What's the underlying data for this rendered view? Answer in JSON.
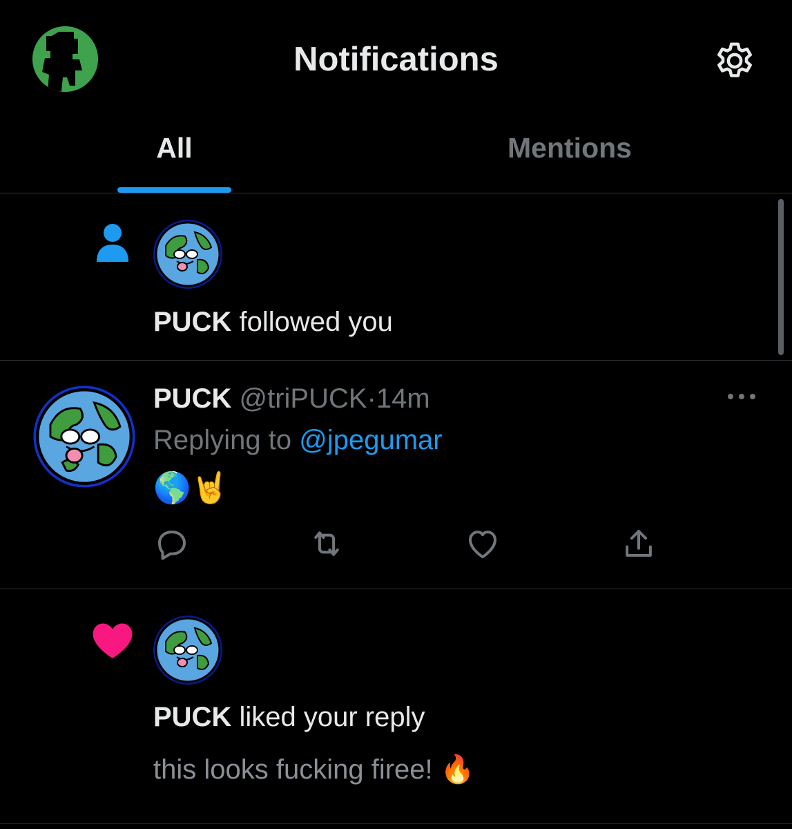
{
  "header": {
    "title": "Notifications",
    "avatar_icon": "profile-avatar-icon",
    "settings_icon": "gear-icon"
  },
  "tabs": [
    {
      "label": "All",
      "active": true
    },
    {
      "label": "Mentions",
      "active": false
    }
  ],
  "colors": {
    "accent": "#1d9bf0",
    "like": "#f91880",
    "background": "#000000",
    "secondary_text": "#71767b"
  },
  "notifications": [
    {
      "type": "follow",
      "icon": "person-icon",
      "user": "PUCK",
      "action": "followed you"
    },
    {
      "type": "reply",
      "name": "PUCK",
      "handle": "@triPUCK",
      "separator": "·",
      "time": "14m",
      "replying_prefix": "Replying to",
      "replying_to": "@jpegumar",
      "body": "🌎🤘",
      "icons": [
        "reply-icon",
        "retweet-icon",
        "heart-outline-icon",
        "share-icon",
        "more-icon"
      ]
    },
    {
      "type": "like",
      "icon": "heart-filled-icon",
      "user": "PUCK",
      "action": "liked your reply",
      "quoted": "this looks fucking firee! 🔥"
    }
  ]
}
